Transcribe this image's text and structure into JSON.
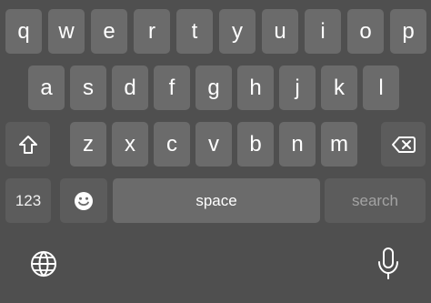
{
  "keyboard": {
    "rows": [
      {
        "keys": [
          "q",
          "w",
          "e",
          "r",
          "t",
          "y",
          "u",
          "i",
          "o",
          "p"
        ]
      },
      {
        "keys": [
          "a",
          "s",
          "d",
          "f",
          "g",
          "h",
          "j",
          "k",
          "l"
        ]
      },
      {
        "keys": [
          "z",
          "x",
          "c",
          "v",
          "b",
          "n",
          "m"
        ]
      }
    ],
    "numbers_label": "123",
    "space_label": "space",
    "search_label": "search",
    "icons": {
      "shift": "shift-icon",
      "backspace": "backspace-icon",
      "emoji": "emoji-icon",
      "globe": "globe-icon",
      "microphone": "microphone-icon"
    },
    "colors": {
      "background": "#4f4f4f",
      "letter_key": "#6b6b6b",
      "special_key": "#5c5c5c",
      "label": "#ffffff",
      "search_label": "#a3a3a3"
    }
  }
}
